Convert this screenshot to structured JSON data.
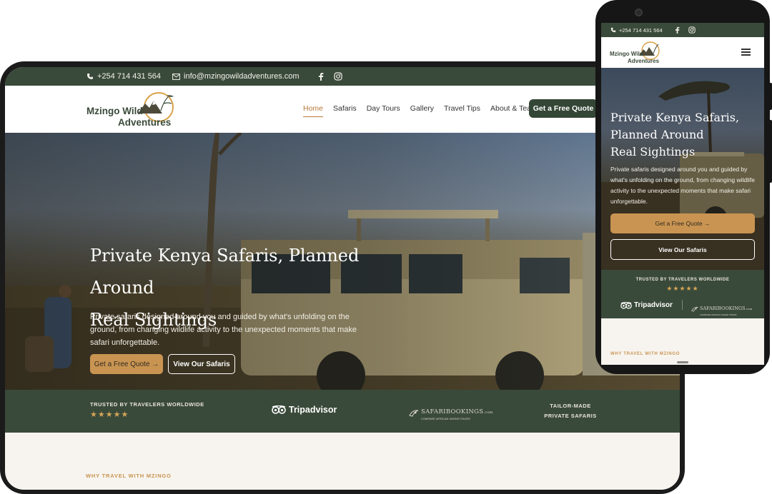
{
  "brand": {
    "name_line1": "Mzingo Wild",
    "name_line2": "Adventures",
    "colors": {
      "forest": "#3a4a3a",
      "gold": "#c99452",
      "cream": "#f7f4ef"
    }
  },
  "contact": {
    "phone": "+254 714 431 564",
    "email": "info@mzingowildadventures.com",
    "phone_icon": "phone-icon",
    "email_icon": "mail-icon",
    "social": [
      "facebook-icon",
      "instagram-icon"
    ]
  },
  "nav": {
    "items": [
      "Home",
      "Safaris",
      "Day Tours",
      "Gallery",
      "Travel Tips",
      "About & Team"
    ],
    "active": "Home",
    "cta": "Get a Free Quote"
  },
  "hero": {
    "title_line1": "Private Kenya Safaris, Planned Around",
    "title_line2": "Real Sightings",
    "mobile_title_line1": "Private Kenya Safaris,",
    "mobile_title_line2": "Planned Around",
    "mobile_title_line3": "Real Sightings",
    "subtitle": "Private safaris designed around you and guided by what's unfolding on the ground, from changing wildlife activity to the unexpected moments that make safari unforgettable.",
    "primary_cta": "Get a Free Quote →",
    "secondary_cta": "View Our Safaris"
  },
  "trust": {
    "label": "TRUSTED BY TRAVELERS WORLDWIDE",
    "stars": "★★★★★",
    "tripadvisor": "Tripadvisor",
    "safaribookings": "SAFARIBOOKINGS",
    "safaribookings_suffix": ".com",
    "safaribookings_tagline": "COMPARE AFRICAN SAFARI TOURS",
    "tailor_line1": "TAILOR-MADE",
    "tailor_line2": "PRIVATE SAFARIS"
  },
  "why": {
    "label": "WHY TRAVEL WITH MZINGO"
  },
  "mobile": {
    "menu_icon": "hamburger-menu-icon"
  }
}
